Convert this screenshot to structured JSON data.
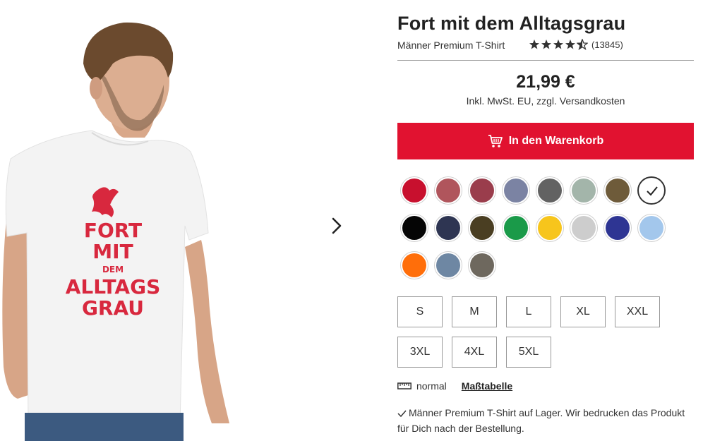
{
  "product": {
    "title": "Fort mit dem Alltagsgrau",
    "subtitle": "Männer Premium T-Shirt",
    "rating_stars": 4.5,
    "review_count": "(13845)",
    "price": "21,99 €",
    "tax_note": "Inkl. MwSt. EU, zzgl. Versandkosten",
    "print_lines": [
      "FORT",
      "MIT",
      "DEM",
      "ALLTAGS",
      "GRAU"
    ]
  },
  "cart": {
    "button_label": "In den Warenkorb",
    "icon": "cart-icon"
  },
  "colors": [
    {
      "name": "rot",
      "hex": "#c8102e"
    },
    {
      "name": "rose",
      "hex": "#b0555c"
    },
    {
      "name": "bordeaux",
      "hex": "#9a3d4c"
    },
    {
      "name": "blaugrau",
      "hex": "#7b83a3"
    },
    {
      "name": "dunkelgrau",
      "hex": "#626262"
    },
    {
      "name": "salbei",
      "hex": "#a3b5aa"
    },
    {
      "name": "oliv-braun",
      "hex": "#6e5b3a"
    },
    {
      "name": "weiss",
      "hex": "#ffffff",
      "selected": true
    },
    {
      "name": "schwarz",
      "hex": "#050505"
    },
    {
      "name": "navy",
      "hex": "#2e3552"
    },
    {
      "name": "dunkeloliv",
      "hex": "#4a3e22"
    },
    {
      "name": "gruen",
      "hex": "#1a9a49"
    },
    {
      "name": "gelb",
      "hex": "#f7c51c"
    },
    {
      "name": "hellgrau",
      "hex": "#cdcdcd"
    },
    {
      "name": "royalblau",
      "hex": "#2e3593"
    },
    {
      "name": "hellblau",
      "hex": "#a3c7ec"
    },
    {
      "name": "orange",
      "hex": "#ff6e0a"
    },
    {
      "name": "taubenblau",
      "hex": "#6e87a3"
    },
    {
      "name": "khakigrau",
      "hex": "#6e685e"
    }
  ],
  "sizes": [
    "S",
    "M",
    "L",
    "XL",
    "XXL",
    "3XL",
    "4XL",
    "5XL"
  ],
  "fit": {
    "icon": "ruler-icon",
    "label": "normal",
    "size_chart_link": "Maßtabelle"
  },
  "stock": {
    "icon": "check-icon",
    "text": "Männer Premium T-Shirt auf Lager. Wir bedrucken das Produkt für Dich nach der Bestellung."
  },
  "gallery": {
    "next_icon": "chevron-right-icon"
  },
  "accent_color": "#e11230"
}
